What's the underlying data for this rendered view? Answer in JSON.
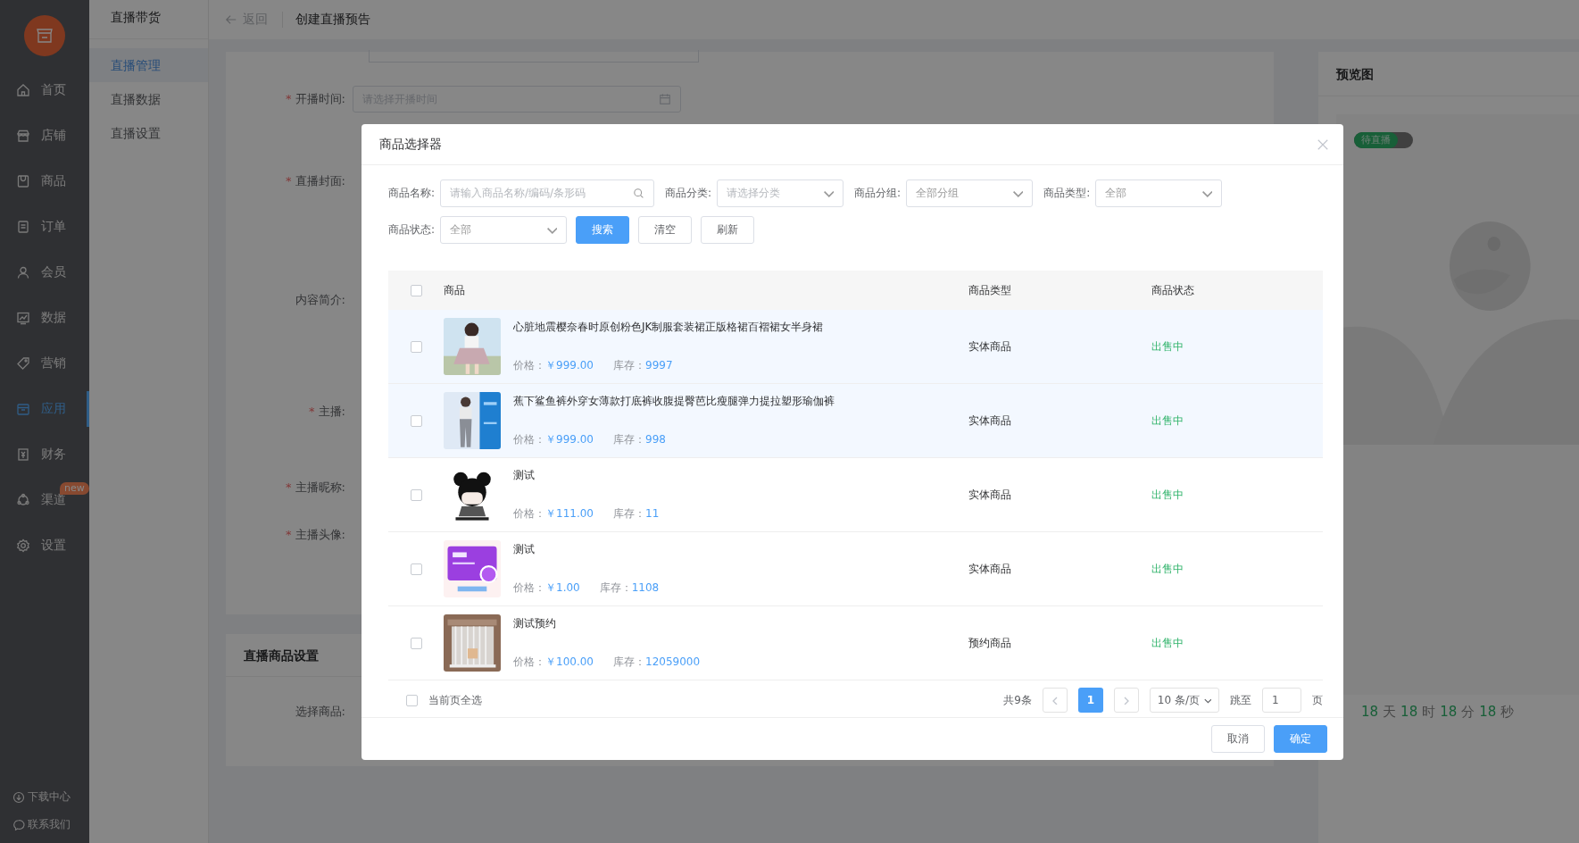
{
  "sidebar": {
    "items": [
      {
        "label": "首页",
        "selected": false
      },
      {
        "label": "店铺",
        "selected": false
      },
      {
        "label": "商品",
        "selected": false
      },
      {
        "label": "订单",
        "selected": false
      },
      {
        "label": "会员",
        "selected": false
      },
      {
        "label": "数据",
        "selected": false
      },
      {
        "label": "营销",
        "selected": false
      },
      {
        "label": "应用",
        "selected": true
      },
      {
        "label": "财务",
        "selected": false
      },
      {
        "label": "渠道",
        "selected": false,
        "badge": "new"
      },
      {
        "label": "设置",
        "selected": false
      }
    ],
    "footer": [
      {
        "label": "下载中心"
      },
      {
        "label": "联系我们"
      }
    ]
  },
  "subnav": {
    "title": "直播带货",
    "items": [
      {
        "label": "直播管理",
        "selected": true
      },
      {
        "label": "直播数据",
        "selected": false
      },
      {
        "label": "直播设置",
        "selected": false
      }
    ]
  },
  "header": {
    "back": "返回",
    "title": "创建直播预告"
  },
  "form": {
    "required_mark": "*",
    "fields": [
      {
        "label": "开播时间:",
        "required": true,
        "kind": "date",
        "placeholder": "请选择开播时间"
      },
      {
        "label": "直播封面:",
        "required": true,
        "kind": "upload"
      },
      {
        "label": "内容简介:",
        "required": false,
        "kind": "textarea"
      },
      {
        "label": "主播:",
        "required": true,
        "kind": "select"
      },
      {
        "label": "主播昵称:",
        "required": true,
        "kind": "text"
      },
      {
        "label": "主播头像:",
        "required": true
      }
    ],
    "goods_section": {
      "title": "直播商品设置",
      "label": "选择商品:"
    }
  },
  "preview": {
    "title": "预览图",
    "badge": "待直播",
    "countdown": [
      {
        "value": "18",
        "unit": "天"
      },
      {
        "value": "18",
        "unit": "时"
      },
      {
        "value": "18",
        "unit": "分"
      },
      {
        "value": "18",
        "unit": "秒"
      }
    ]
  },
  "modal": {
    "title": "商品选择器",
    "filters": [
      {
        "label": "商品名称:",
        "kind": "search",
        "placeholder": "请输入商品名称/编码/条形码"
      },
      {
        "label": "商品分类:",
        "kind": "select",
        "placeholder": "请选择分类"
      },
      {
        "label": "商品分组:",
        "kind": "select",
        "value": "全部分组"
      },
      {
        "label": "商品类型:",
        "kind": "select",
        "value": "全部"
      },
      {
        "label": "商品状态:",
        "kind": "select",
        "value": "全部"
      }
    ],
    "buttons": [
      {
        "label": "搜索",
        "kind": "primary"
      },
      {
        "label": "清空",
        "kind": "default"
      },
      {
        "label": "刷新",
        "kind": "default"
      }
    ],
    "table": {
      "all_checked": false,
      "columns": [
        "商品",
        "商品类型",
        "商品状态"
      ],
      "rows": [
        {
          "checked": false,
          "highlighted": true,
          "name": "心脏地震樱奈春时原创粉色JK制服套装裙正版格裙百褶裙女半身裙",
          "price_label": "价格：",
          "price": "￥999.00",
          "stock_label": "库存：",
          "stock": "9997",
          "type": "实体商品",
          "status": "出售中"
        },
        {
          "checked": false,
          "highlighted": true,
          "name": "蕉下鲨鱼裤外穿女薄款打底裤收腹提臀芭比瘦腿弹力提拉塑形瑜伽裤",
          "price_label": "价格：",
          "price": "￥999.00",
          "stock_label": "库存：",
          "stock": "998",
          "type": "实体商品",
          "status": "出售中"
        },
        {
          "checked": false,
          "highlighted": false,
          "name": "测试",
          "price_label": "价格：",
          "price": "￥111.00",
          "stock_label": "库存：",
          "stock": "11",
          "type": "实体商品",
          "status": "出售中"
        },
        {
          "checked": false,
          "highlighted": false,
          "name": "测试",
          "price_label": "价格：",
          "price": "￥1.00",
          "stock_label": "库存：",
          "stock": "1108",
          "type": "实体商品",
          "status": "出售中"
        },
        {
          "checked": false,
          "highlighted": false,
          "name": "测试预约",
          "price_label": "价格：",
          "price": "￥100.00",
          "stock_label": "库存：",
          "stock": "12059000",
          "type": "预约商品",
          "status": "出售中"
        }
      ]
    },
    "select_all": {
      "label": "当前页全选",
      "checked": false
    },
    "pagination": {
      "total": "共9条",
      "pages": [
        {
          "label": "1",
          "selected": true
        }
      ],
      "page_size": "10 条/页",
      "jump_label": "跳至",
      "jump_value": "1",
      "page_unit": "页"
    },
    "footer_buttons": [
      {
        "label": "取消",
        "kind": "default"
      },
      {
        "label": "确定",
        "kind": "primary"
      }
    ]
  }
}
